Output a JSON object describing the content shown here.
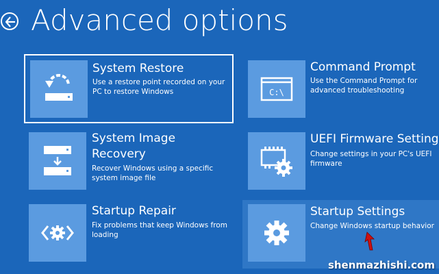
{
  "header": {
    "title": "Advanced options"
  },
  "tiles": {
    "system_restore": {
      "title": "System Restore",
      "desc": "Use a restore point recorded on your PC to restore Windows"
    },
    "command_prompt": {
      "title": "Command Prompt",
      "desc": "Use the Command Prompt for advanced troubleshooting"
    },
    "system_image_recovery": {
      "title_line1": "System Image",
      "title_line2": "Recovery",
      "desc": "Recover Windows using a specific system image file"
    },
    "uefi_firmware": {
      "title": "UEFI Firmware Settings",
      "desc": "Change settings in your PC's UEFI firmware"
    },
    "startup_repair": {
      "title": "Startup Repair",
      "desc": "Fix problems that keep Windows from loading"
    },
    "startup_settings": {
      "title": "Startup Settings",
      "desc": "Change Windows startup behavior"
    }
  },
  "icons": {
    "back": "back-arrow-icon",
    "system_restore": "restore-icon",
    "command_prompt": "command-prompt-icon",
    "system_image_recovery": "system-image-icon",
    "uefi_firmware": "firmware-chip-icon",
    "startup_repair": "code-gear-icon",
    "startup_settings": "gear-icon"
  },
  "colors": {
    "background": "#1b66ba",
    "tile_icon_bg": "#5b9be0",
    "hover_tile_bg": "#2f77c6",
    "text": "#ffffff",
    "cursor_arrow": "#cc1111"
  },
  "watermark": "shenmazhishi.com"
}
